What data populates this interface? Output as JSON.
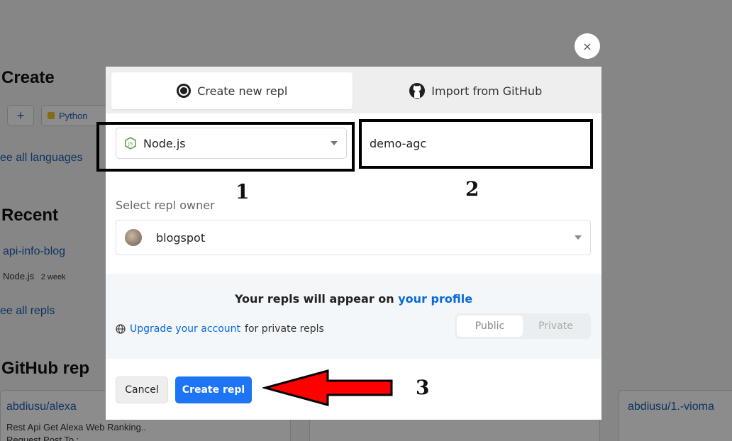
{
  "background": {
    "create_heading": "Create",
    "plus_symbol": "+",
    "python_label": "Python",
    "see_all_languages": "ee all languages",
    "recent_heading": "Recent",
    "recent_item": "api-info-blog",
    "recent_item_lang": "Node.js",
    "recent_item_time": "2 week",
    "see_all_repls": "ee all repls",
    "github_heading": "GitHub rep",
    "gh_item1": "abdiusu/alexa",
    "gh_item1_desc": "Rest Api Get Alexa Web Ranking..",
    "gh_item1_desc2": "Request Post To :",
    "gh_item2": "abdiusu/1.-vioma"
  },
  "modal": {
    "close_symbol": "×",
    "tabs": [
      {
        "label": "Create new repl",
        "icon": "replit-icon",
        "active": true
      },
      {
        "label": "Import from GitHub",
        "icon": "github-icon",
        "active": false
      }
    ],
    "language": {
      "value": "Node.js",
      "icon": "nodejs-icon"
    },
    "repl_name": {
      "value": "demo-agc"
    },
    "owner": {
      "label": "Select repl owner",
      "value": "blogspot"
    },
    "info": {
      "heading_prefix": "Your repls will appear on ",
      "heading_link": "your profile",
      "upgrade_link": "Upgrade your account",
      "upgrade_suffix": "for private repls",
      "visibility": [
        "Public",
        "Private"
      ],
      "selected": "Public"
    },
    "cancel_label": "Cancel",
    "create_label": "Create repl"
  },
  "annotations": {
    "n1": "1",
    "n2": "2",
    "n3": "3",
    "box_color": "#000000",
    "arrow_color": "#ff0000"
  },
  "colors": {
    "primary": "#1d74f5",
    "link": "#0969da"
  }
}
